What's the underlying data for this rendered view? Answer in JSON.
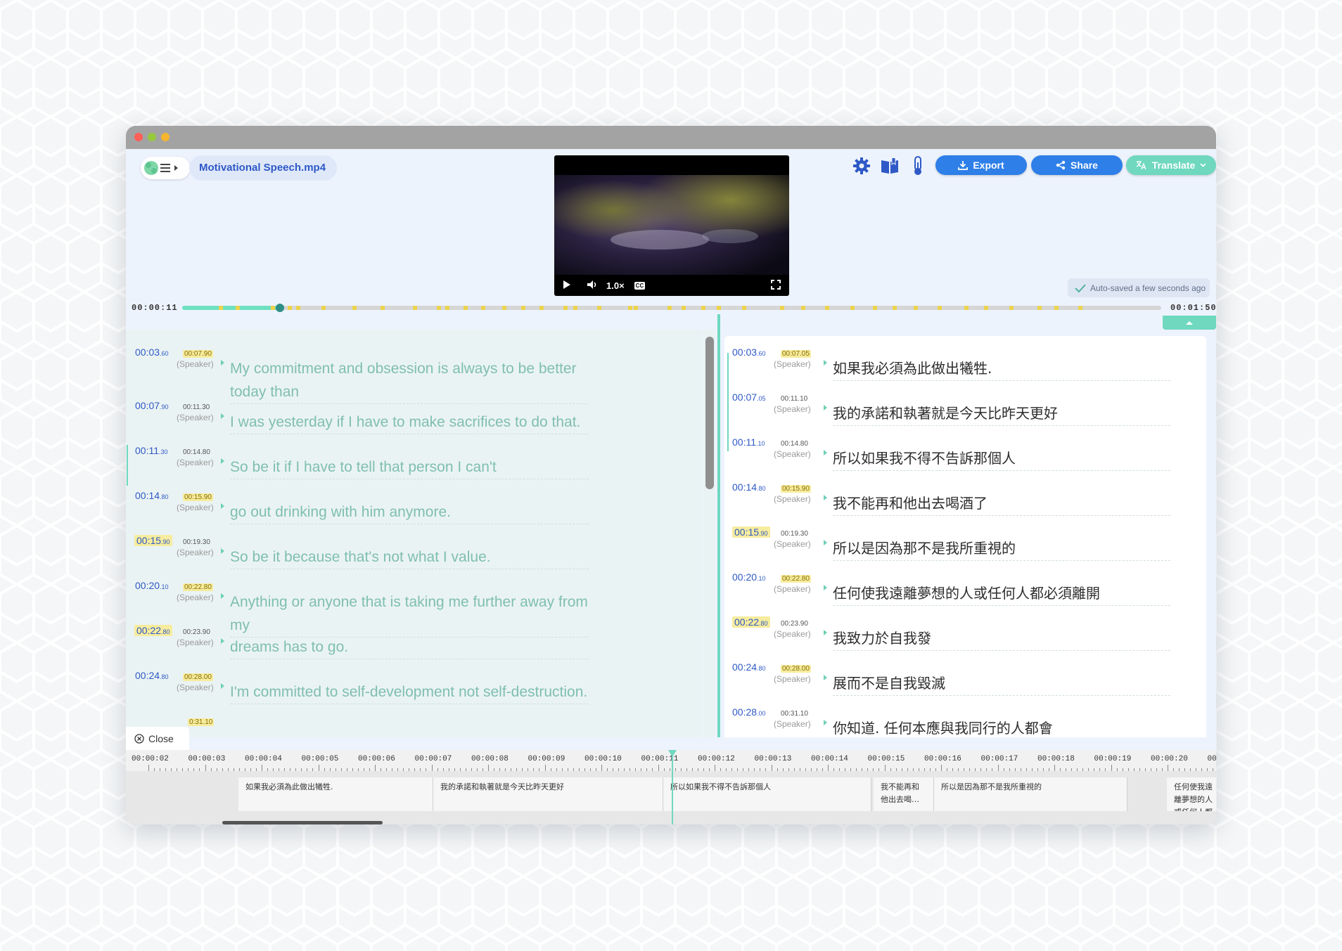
{
  "app": {
    "file_name": "Motivational Speech.mp4"
  },
  "header": {
    "icons": [
      "gear-icon",
      "book-icon",
      "thermometer-icon"
    ],
    "export_label": "Export",
    "share_label": "Share",
    "translate_label": "Translate",
    "autosave": "Auto-saved a few seconds ago"
  },
  "player": {
    "speed": "1.0×",
    "cc": "CC",
    "current_time": "00:00:11",
    "total_time": "00:01:50",
    "progress": 0.1
  },
  "colors": {
    "accent_blue": "#2e59c6",
    "accent_teal": "#6fd8bf",
    "highlight": "#f6ec9e",
    "translate_btn": "#6fd8bf"
  },
  "left_segments": [
    {
      "start": "00:03",
      "start_ms": ".60",
      "end": "00:07",
      "end_ms": ".90",
      "speaker": "(Speaker)",
      "text": "My commitment and obsession is always to be better today than"
    },
    {
      "start": "00:07",
      "start_ms": ".90",
      "end": "00:11",
      "end_ms": ".30",
      "speaker": "(Speaker)",
      "text": "I was yesterday if I have to make sacrifices to do that."
    },
    {
      "start": "00:11",
      "start_ms": ".30",
      "end": "00:14",
      "end_ms": ".80",
      "speaker": "(Speaker)",
      "text": "So be it if I have to tell that person I can't"
    },
    {
      "start": "00:14",
      "start_ms": ".80",
      "end": "00:15",
      "end_ms": ".90",
      "speaker": "(Speaker)",
      "text": "go out drinking with him anymore."
    },
    {
      "start": "00:15",
      "start_ms": ".90",
      "end": "00:19",
      "end_ms": ".30",
      "speaker": "(Speaker)",
      "text": "So be it because that's not what I value."
    },
    {
      "start": "00:20",
      "start_ms": ".10",
      "end": "00:22",
      "end_ms": ".80",
      "speaker": "(Speaker)",
      "text": "Anything or anyone that is taking me further away from my"
    },
    {
      "start": "00:22",
      "start_ms": ".80",
      "end": "00:23",
      "end_ms": ".90",
      "speaker": "(Speaker)",
      "text": "dreams has to go."
    },
    {
      "start": "00:24",
      "start_ms": ".80",
      "end": "00:28",
      "end_ms": ".00",
      "speaker": "(Speaker)",
      "text": "I'm committed to self-development not self-destruction."
    },
    {
      "start": "",
      "start_ms": "",
      "end": "0:31",
      "end_ms": ".10",
      "speaker": "",
      "text": ""
    }
  ],
  "right_segments": [
    {
      "start": "00:03",
      "start_ms": ".60",
      "end": "00:07",
      "end_ms": ".05",
      "speaker": "(Speaker)",
      "text": "如果我必須為此做出犧牲."
    },
    {
      "start": "00:07",
      "start_ms": ".05",
      "end": "00:11",
      "end_ms": ".10",
      "speaker": "(Speaker)",
      "text": "我的承諾和執著就是今天比昨天更好"
    },
    {
      "start": "00:11",
      "start_ms": ".10",
      "end": "00:14",
      "end_ms": ".80",
      "speaker": "(Speaker)",
      "text": "所以如果我不得不告訴那個人"
    },
    {
      "start": "00:14",
      "start_ms": ".80",
      "end": "00:15",
      "end_ms": ".90",
      "speaker": "(Speaker)",
      "text": "我不能再和他出去喝酒了"
    },
    {
      "start": "00:15",
      "start_ms": ".90",
      "end": "00:19",
      "end_ms": ".30",
      "speaker": "(Speaker)",
      "text": "所以是因為那不是我所重視的"
    },
    {
      "start": "00:20",
      "start_ms": ".10",
      "end": "00:22",
      "end_ms": ".80",
      "speaker": "(Speaker)",
      "text": "任何使我遠離夢想的人或任何人都必須離開"
    },
    {
      "start": "00:22",
      "start_ms": ".80",
      "end": "00:23",
      "end_ms": ".90",
      "speaker": "(Speaker)",
      "text": "我致力於自我發"
    },
    {
      "start": "00:24",
      "start_ms": ".80",
      "end": "00:28",
      "end_ms": ".00",
      "speaker": "(Speaker)",
      "text": "展而不是自我毀滅"
    },
    {
      "start": "00:28",
      "start_ms": ".00",
      "end": "00:31",
      "end_ms": ".10",
      "speaker": "(Speaker)",
      "text": "你知道. 任何本應與我同行的人都會"
    }
  ],
  "close_label": "Close",
  "timeline": {
    "ruler": [
      "00:00:02",
      "00:00:03",
      "00:00:04",
      "00:00:05",
      "00:00:06",
      "00:00:07",
      "00:00:08",
      "00:00:09",
      "00:00:10",
      "00:00:11",
      "00:00:12",
      "00:00:13",
      "00:00:14",
      "00:00:15",
      "00:00:16",
      "00:00:17",
      "00:00:18",
      "00:00:19",
      "00:00:20",
      "00:0"
    ],
    "captions": [
      "如果我必須為此做出犧牲.",
      "我的承諾和執著就是今天比昨天更好",
      "所以如果我不得不告訴那個人",
      "我不能再和他出去喝…",
      "所以是因為那不是我所重視的",
      "任何使我遠離夢想的人或任何人都必須離開"
    ]
  }
}
